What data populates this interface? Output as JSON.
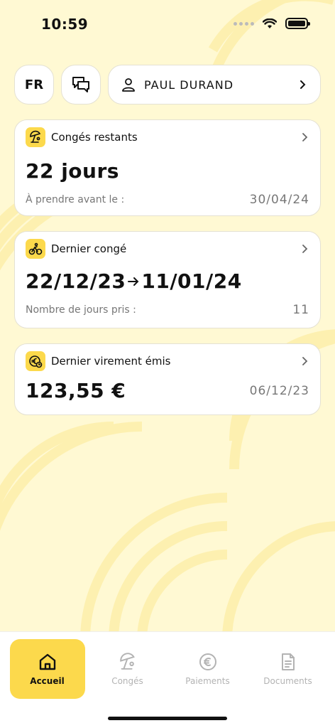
{
  "status": {
    "time": "10:59"
  },
  "header": {
    "language": "FR",
    "user_name": "PAUL DURAND"
  },
  "cards": [
    {
      "title": "Congés restants",
      "icon": "beach-umbrella-icon",
      "value": "22 jours",
      "footer_label": "À prendre avant le :",
      "footer_value": "30/04/24"
    },
    {
      "title": "Dernier congé",
      "icon": "cyclist-icon",
      "range_start": "22/12/23",
      "range_end": "11/01/24",
      "footer_label": "Nombre de jours pris :",
      "footer_value": "11"
    },
    {
      "title": "Dernier virement émis",
      "icon": "euro-clock-icon",
      "value": "123,55 €",
      "date": "06/12/23"
    }
  ],
  "tabs": [
    {
      "label": "Accueil",
      "icon": "home-icon",
      "active": true
    },
    {
      "label": "Congés",
      "icon": "beach-umbrella-icon",
      "active": false
    },
    {
      "label": "Paiements",
      "icon": "euro-icon",
      "active": false
    },
    {
      "label": "Documents",
      "icon": "document-icon",
      "active": false
    }
  ],
  "colors": {
    "accent": "#fcd94c",
    "background": "#fff9d3"
  }
}
